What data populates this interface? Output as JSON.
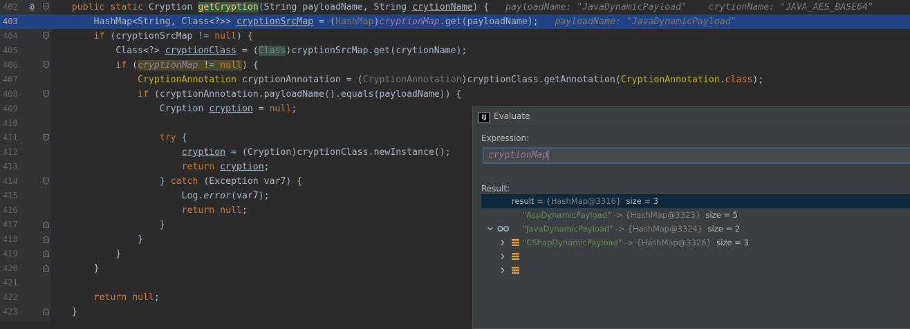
{
  "editor": {
    "lines": [
      {
        "num": "402",
        "mark": "@",
        "segs": [
          [
            "",
            "    "
          ],
          [
            "kw",
            "public static "
          ],
          [
            "",
            "Cryption "
          ],
          [
            "fn-hl",
            "getCryption"
          ],
          [
            "",
            "(String payloadName, String "
          ],
          [
            "ul",
            "crytionName"
          ],
          [
            "",
            ") {  "
          ],
          [
            "hint",
            " payloadName: \"JavaDynamicPayload\"    crytionName: \"JAVA_AES_BASE64\""
          ]
        ]
      },
      {
        "num": "403",
        "current": true,
        "segs": [
          [
            "",
            "        HashMap<String, Class<?>> "
          ],
          [
            "ul",
            "cryptionSrcMap"
          ],
          [
            "",
            " = ("
          ],
          [
            "gray",
            "HashMap"
          ],
          [
            "",
            ")"
          ],
          [
            "fld",
            "cryptionMap"
          ],
          [
            "",
            ".get(payloadName);  "
          ],
          [
            "hint",
            " payloadName: \"JavaDynamicPayload\""
          ]
        ]
      },
      {
        "num": "404",
        "segs": [
          [
            "",
            "        "
          ],
          [
            "kw",
            "if "
          ],
          [
            "",
            "(cryptionSrcMap != "
          ],
          [
            "kw",
            "null"
          ],
          [
            "",
            ") {"
          ]
        ]
      },
      {
        "num": "405",
        "segs": [
          [
            "",
            "            Class<?> "
          ],
          [
            "ul",
            "cryptionClass"
          ],
          [
            "",
            " = ("
          ],
          [
            "cast-hl",
            "Class"
          ],
          [
            "",
            ")cryptionSrcMap.get(crytionName);"
          ]
        ]
      },
      {
        "num": "406",
        "segs": [
          [
            "",
            "            "
          ],
          [
            "kw",
            "if "
          ],
          [
            "",
            "("
          ],
          [
            "fldhl",
            "cryptionMap"
          ],
          [
            "hl-box",
            " != "
          ],
          [
            "kwhl",
            "null"
          ],
          [
            "",
            ") {"
          ]
        ]
      },
      {
        "num": "407",
        "segs": [
          [
            "",
            "                "
          ],
          [
            "ann",
            "CryptionAnnotation"
          ],
          [
            "",
            " cryptionAnnotation = ("
          ],
          [
            "gray",
            "CryptionAnnotation"
          ],
          [
            "",
            ")cryptionClass.getAnnotation("
          ],
          [
            "ann",
            "CryptionAnnotation"
          ],
          [
            "",
            "."
          ],
          [
            "kw",
            "class"
          ],
          [
            "",
            ");"
          ]
        ]
      },
      {
        "num": "408",
        "segs": [
          [
            "",
            "                "
          ],
          [
            "kw",
            "if "
          ],
          [
            "",
            "(cryptionAnnotation.payloadName().equals(payloadName)) {"
          ]
        ]
      },
      {
        "num": "409",
        "segs": [
          [
            "",
            "                    Cryption "
          ],
          [
            "ul",
            "cryption"
          ],
          [
            "",
            " = "
          ],
          [
            "kw",
            "null"
          ],
          [
            "",
            ";"
          ]
        ]
      },
      {
        "num": "410",
        "segs": [
          [
            "",
            ""
          ]
        ]
      },
      {
        "num": "411",
        "segs": [
          [
            "",
            "                    "
          ],
          [
            "kw",
            "try "
          ],
          [
            "",
            "{"
          ]
        ]
      },
      {
        "num": "412",
        "segs": [
          [
            "",
            "                        "
          ],
          [
            "ul",
            "cryption"
          ],
          [
            "",
            " = (Cryption)cryptionClass.newInstance();"
          ]
        ]
      },
      {
        "num": "413",
        "segs": [
          [
            "",
            "                        "
          ],
          [
            "kw",
            "return "
          ],
          [
            "ul",
            "cryption"
          ],
          [
            "",
            ";"
          ]
        ]
      },
      {
        "num": "414",
        "segs": [
          [
            "",
            "                    } "
          ],
          [
            "kw",
            "catch "
          ],
          [
            "",
            "(Exception var7) {"
          ]
        ]
      },
      {
        "num": "415",
        "segs": [
          [
            "",
            "                        Log."
          ],
          [
            "itl",
            "error"
          ],
          [
            "",
            "(var7);"
          ]
        ]
      },
      {
        "num": "416",
        "segs": [
          [
            "",
            "                        "
          ],
          [
            "kw",
            "return null"
          ],
          [
            "",
            ";"
          ]
        ]
      },
      {
        "num": "417",
        "segs": [
          [
            "",
            "                    }"
          ]
        ]
      },
      {
        "num": "418",
        "segs": [
          [
            "",
            "                }"
          ]
        ]
      },
      {
        "num": "419",
        "segs": [
          [
            "",
            "            }"
          ]
        ]
      },
      {
        "num": "420",
        "segs": [
          [
            "",
            "        }"
          ]
        ]
      },
      {
        "num": "421",
        "segs": [
          [
            "",
            ""
          ]
        ]
      },
      {
        "num": "422",
        "segs": [
          [
            "",
            "        "
          ],
          [
            "kw",
            "return null"
          ],
          [
            "",
            ";"
          ]
        ]
      },
      {
        "num": "423",
        "segs": [
          [
            "",
            "    }"
          ]
        ]
      }
    ]
  },
  "evaluate": {
    "title": "Evaluate",
    "logo": "IJ",
    "expression_label": "Expression:",
    "expression_value": "cryptionMap",
    "result_label": "Result:",
    "result_root": {
      "name": "result",
      "eq": " = ",
      "value": "{HashMap@3316}",
      "size": "  size = 3"
    },
    "entries": [
      {
        "key": "\"AspDynamicPayload\"",
        "arrow": " -> ",
        "value": "{HashMap@3323}",
        "size": "  size = 5"
      },
      {
        "key": "\"JavaDynamicPayload\"",
        "arrow": " -> ",
        "value": "{HashMap@3324}",
        "size": "  size = 2"
      },
      {
        "key": "\"CShapDynamicPayload\"",
        "arrow": " -> ",
        "value": "{HashMap@3326}",
        "size": "  size = 3"
      }
    ]
  },
  "colors": {
    "keyword": "#cc7832",
    "field": "#9876aa",
    "string": "#6a8759",
    "annotation": "#bbb529",
    "selection": "#214283"
  },
  "icons": [
    "override-icon",
    "fold-icon",
    "intellij-logo-icon",
    "watch-glasses-icon",
    "map-entry-icon",
    "chevron-right-icon",
    "chevron-down-icon"
  ]
}
